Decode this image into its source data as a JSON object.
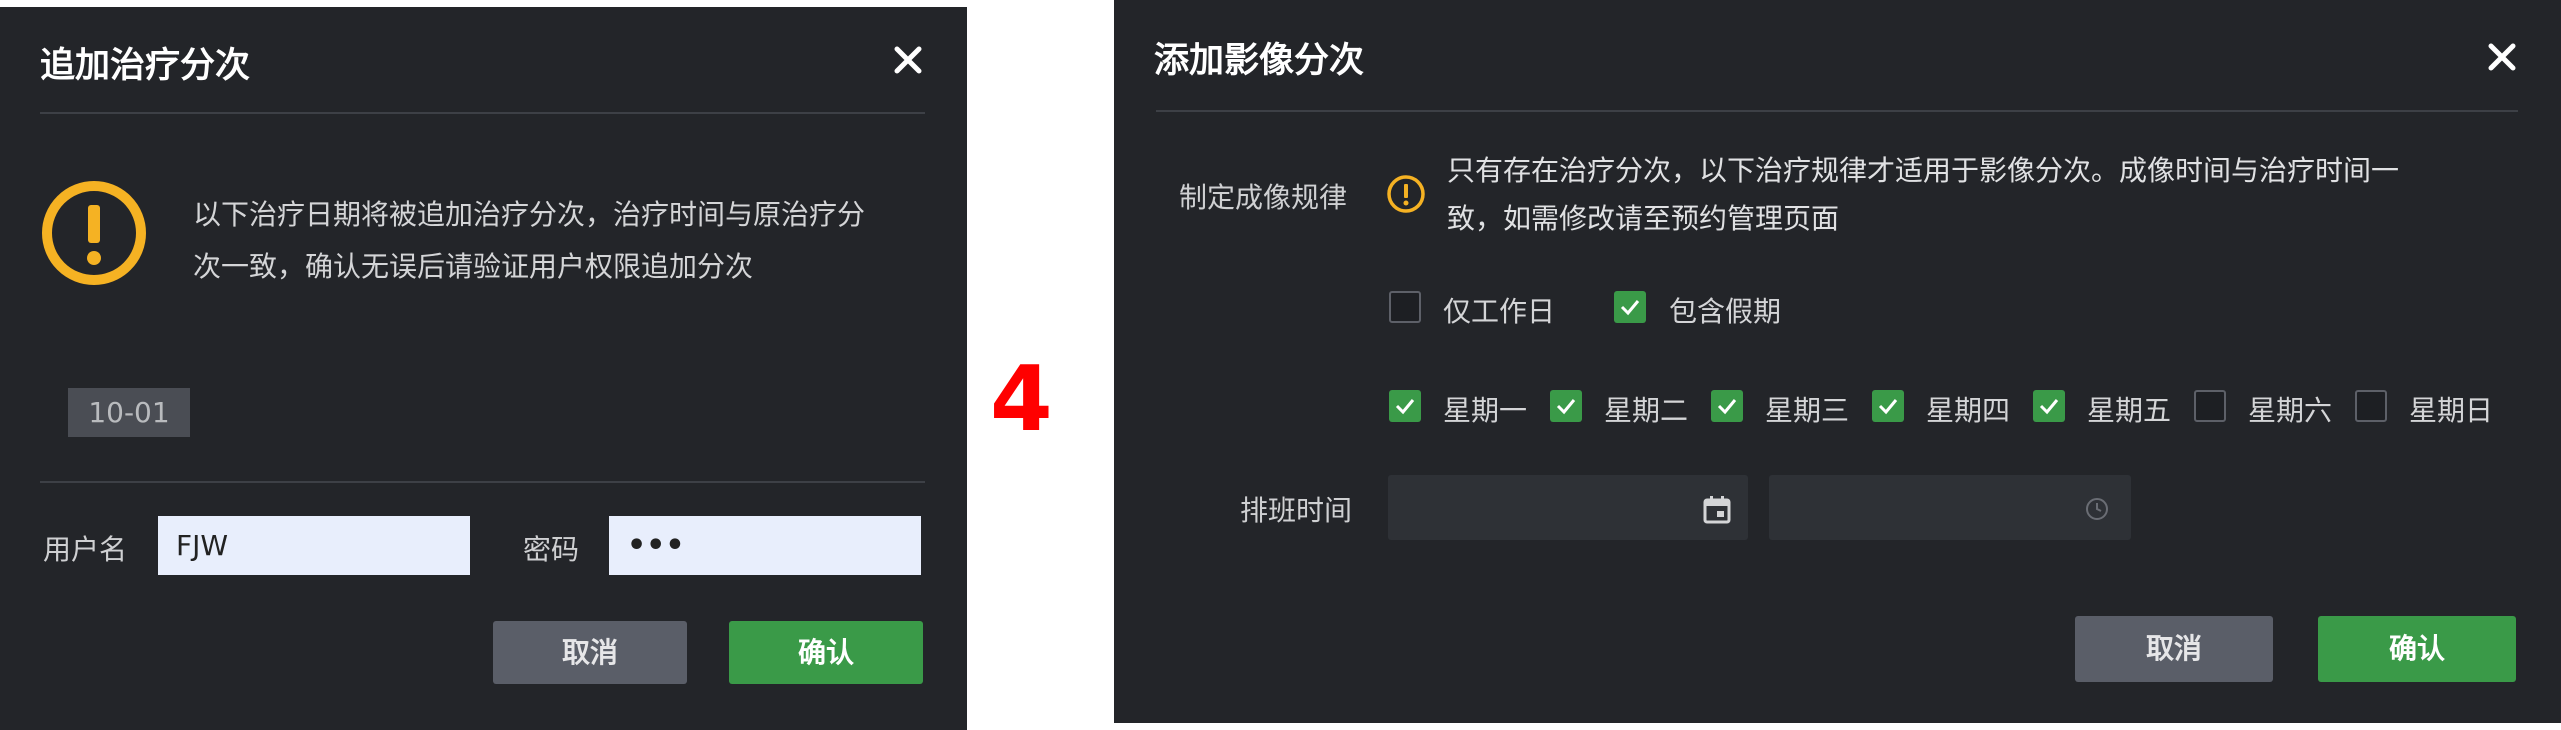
{
  "dialog1": {
    "title": "追加治疗分次",
    "message_line1": "以下治疗日期将被追加治疗分次，治疗时间与原治疗分",
    "message_line2": "次一致，确认无误后请验证用户权限追加分次",
    "date_tag": "10-01",
    "username_label": "用户名",
    "username_value": "FJW",
    "password_label": "密码",
    "password_value": "•••",
    "cancel_label": "取消",
    "confirm_label": "确认"
  },
  "separator_number": "4",
  "dialog2": {
    "title": "添加影像分次",
    "rule_label": "制定成像规律",
    "rule_message_line1": "只有存在治疗分次，以下治疗规律才适用于影像分次。成像时间与治疗时间一",
    "rule_message_line2": "致，如需修改请至预约管理页面",
    "options": [
      {
        "label": "仅工作日",
        "checked": false
      },
      {
        "label": "包含假期",
        "checked": true
      }
    ],
    "weekdays": [
      {
        "label": "星期一",
        "checked": true
      },
      {
        "label": "星期二",
        "checked": true
      },
      {
        "label": "星期三",
        "checked": true
      },
      {
        "label": "星期四",
        "checked": true
      },
      {
        "label": "星期五",
        "checked": true
      },
      {
        "label": "星期六",
        "checked": false
      },
      {
        "label": "星期日",
        "checked": false
      }
    ],
    "schedule_label": "排班时间",
    "date_value": "",
    "time_value": "",
    "cancel_label": "取消",
    "confirm_label": "确认"
  },
  "colors": {
    "dialog_bg": "#232529",
    "accent_green": "#3a9a48",
    "warning_yellow": "#f5b223",
    "annotation_red": "#ff0000"
  }
}
